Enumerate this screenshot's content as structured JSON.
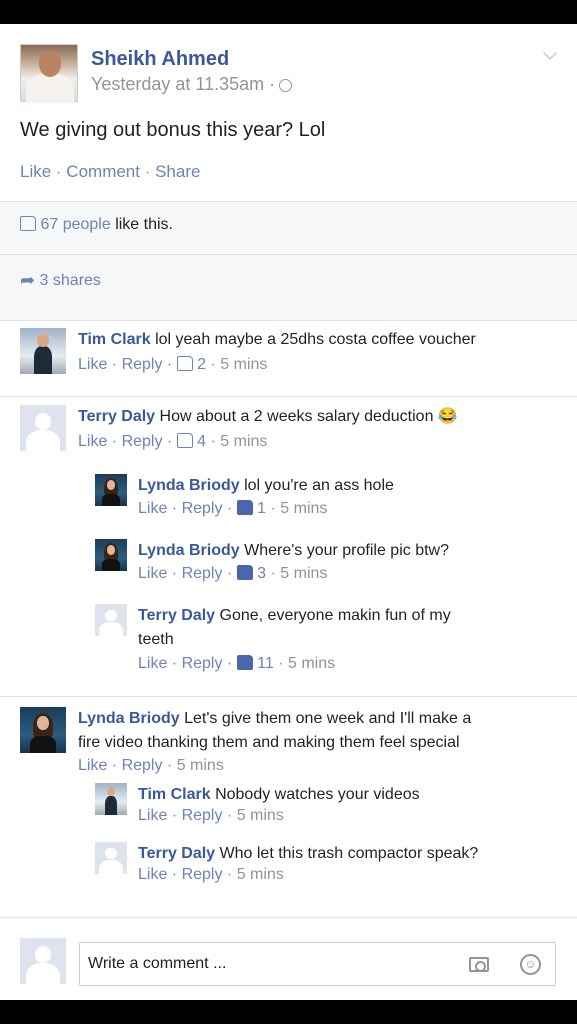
{
  "post": {
    "author": "Sheikh Ahmed",
    "time": "Yesterday at 11.35am ·",
    "text": "We giving out bonus this year? Lol",
    "actions": {
      "like": "Like",
      "comment": "Comment",
      "share": "Share",
      "sep": " · "
    }
  },
  "likes": {
    "count": "67 people",
    "suffix": " like this."
  },
  "shares": {
    "label": "3 shares"
  },
  "comments": [
    {
      "name": "Tim Clark",
      "text": " lol yeah maybe a 25dhs costa coffee voucher",
      "like": "Like",
      "reply": "Reply",
      "count": "2",
      "time": "5 mins"
    },
    {
      "name": "Terry Daly",
      "text": " How about a 2 weeks salary deduction 😂",
      "like": "Like",
      "reply": "Reply",
      "count": "4",
      "time": "5 mins",
      "replies": [
        {
          "name": "Lynda Briody",
          "text": " lol you're an ass hole",
          "like": "Like",
          "reply": "Reply",
          "count": "1",
          "time": "5 mins"
        },
        {
          "name": "Lynda Briody",
          "text": " Where's your profile pic btw?",
          "like": "Like",
          "reply": "Reply",
          "count": "3",
          "time": "5 mins"
        },
        {
          "name": "Terry Daly",
          "text": " Gone, everyone makin fun of my",
          "text2": "teeth",
          "like": "Like",
          "reply": "Reply",
          "count": "11",
          "time": "5 mins"
        }
      ]
    },
    {
      "name": "Lynda Briody",
      "text": " Let's give them one week and I'll make a",
      "text2": "fire video thanking them and making them feel special",
      "like": "Like",
      "reply": "Reply",
      "time": "5 mins",
      "replies": [
        {
          "name": "Tim Clark",
          "text": " Nobody watches your videos",
          "like": "Like",
          "reply": "Reply",
          "time": "5 mins"
        },
        {
          "name": "Terry Daly",
          "text": " Who let this trash compactor speak?",
          "like": "Like",
          "reply": "Reply",
          "time": "5 mins"
        }
      ]
    }
  ],
  "composer": {
    "placeholder": "Write a comment ..."
  },
  "icons": [
    "globe-icon",
    "chevron-down-icon",
    "thumbs-up-icon",
    "share-arrow-icon",
    "camera-icon",
    "emoji-icon"
  ]
}
